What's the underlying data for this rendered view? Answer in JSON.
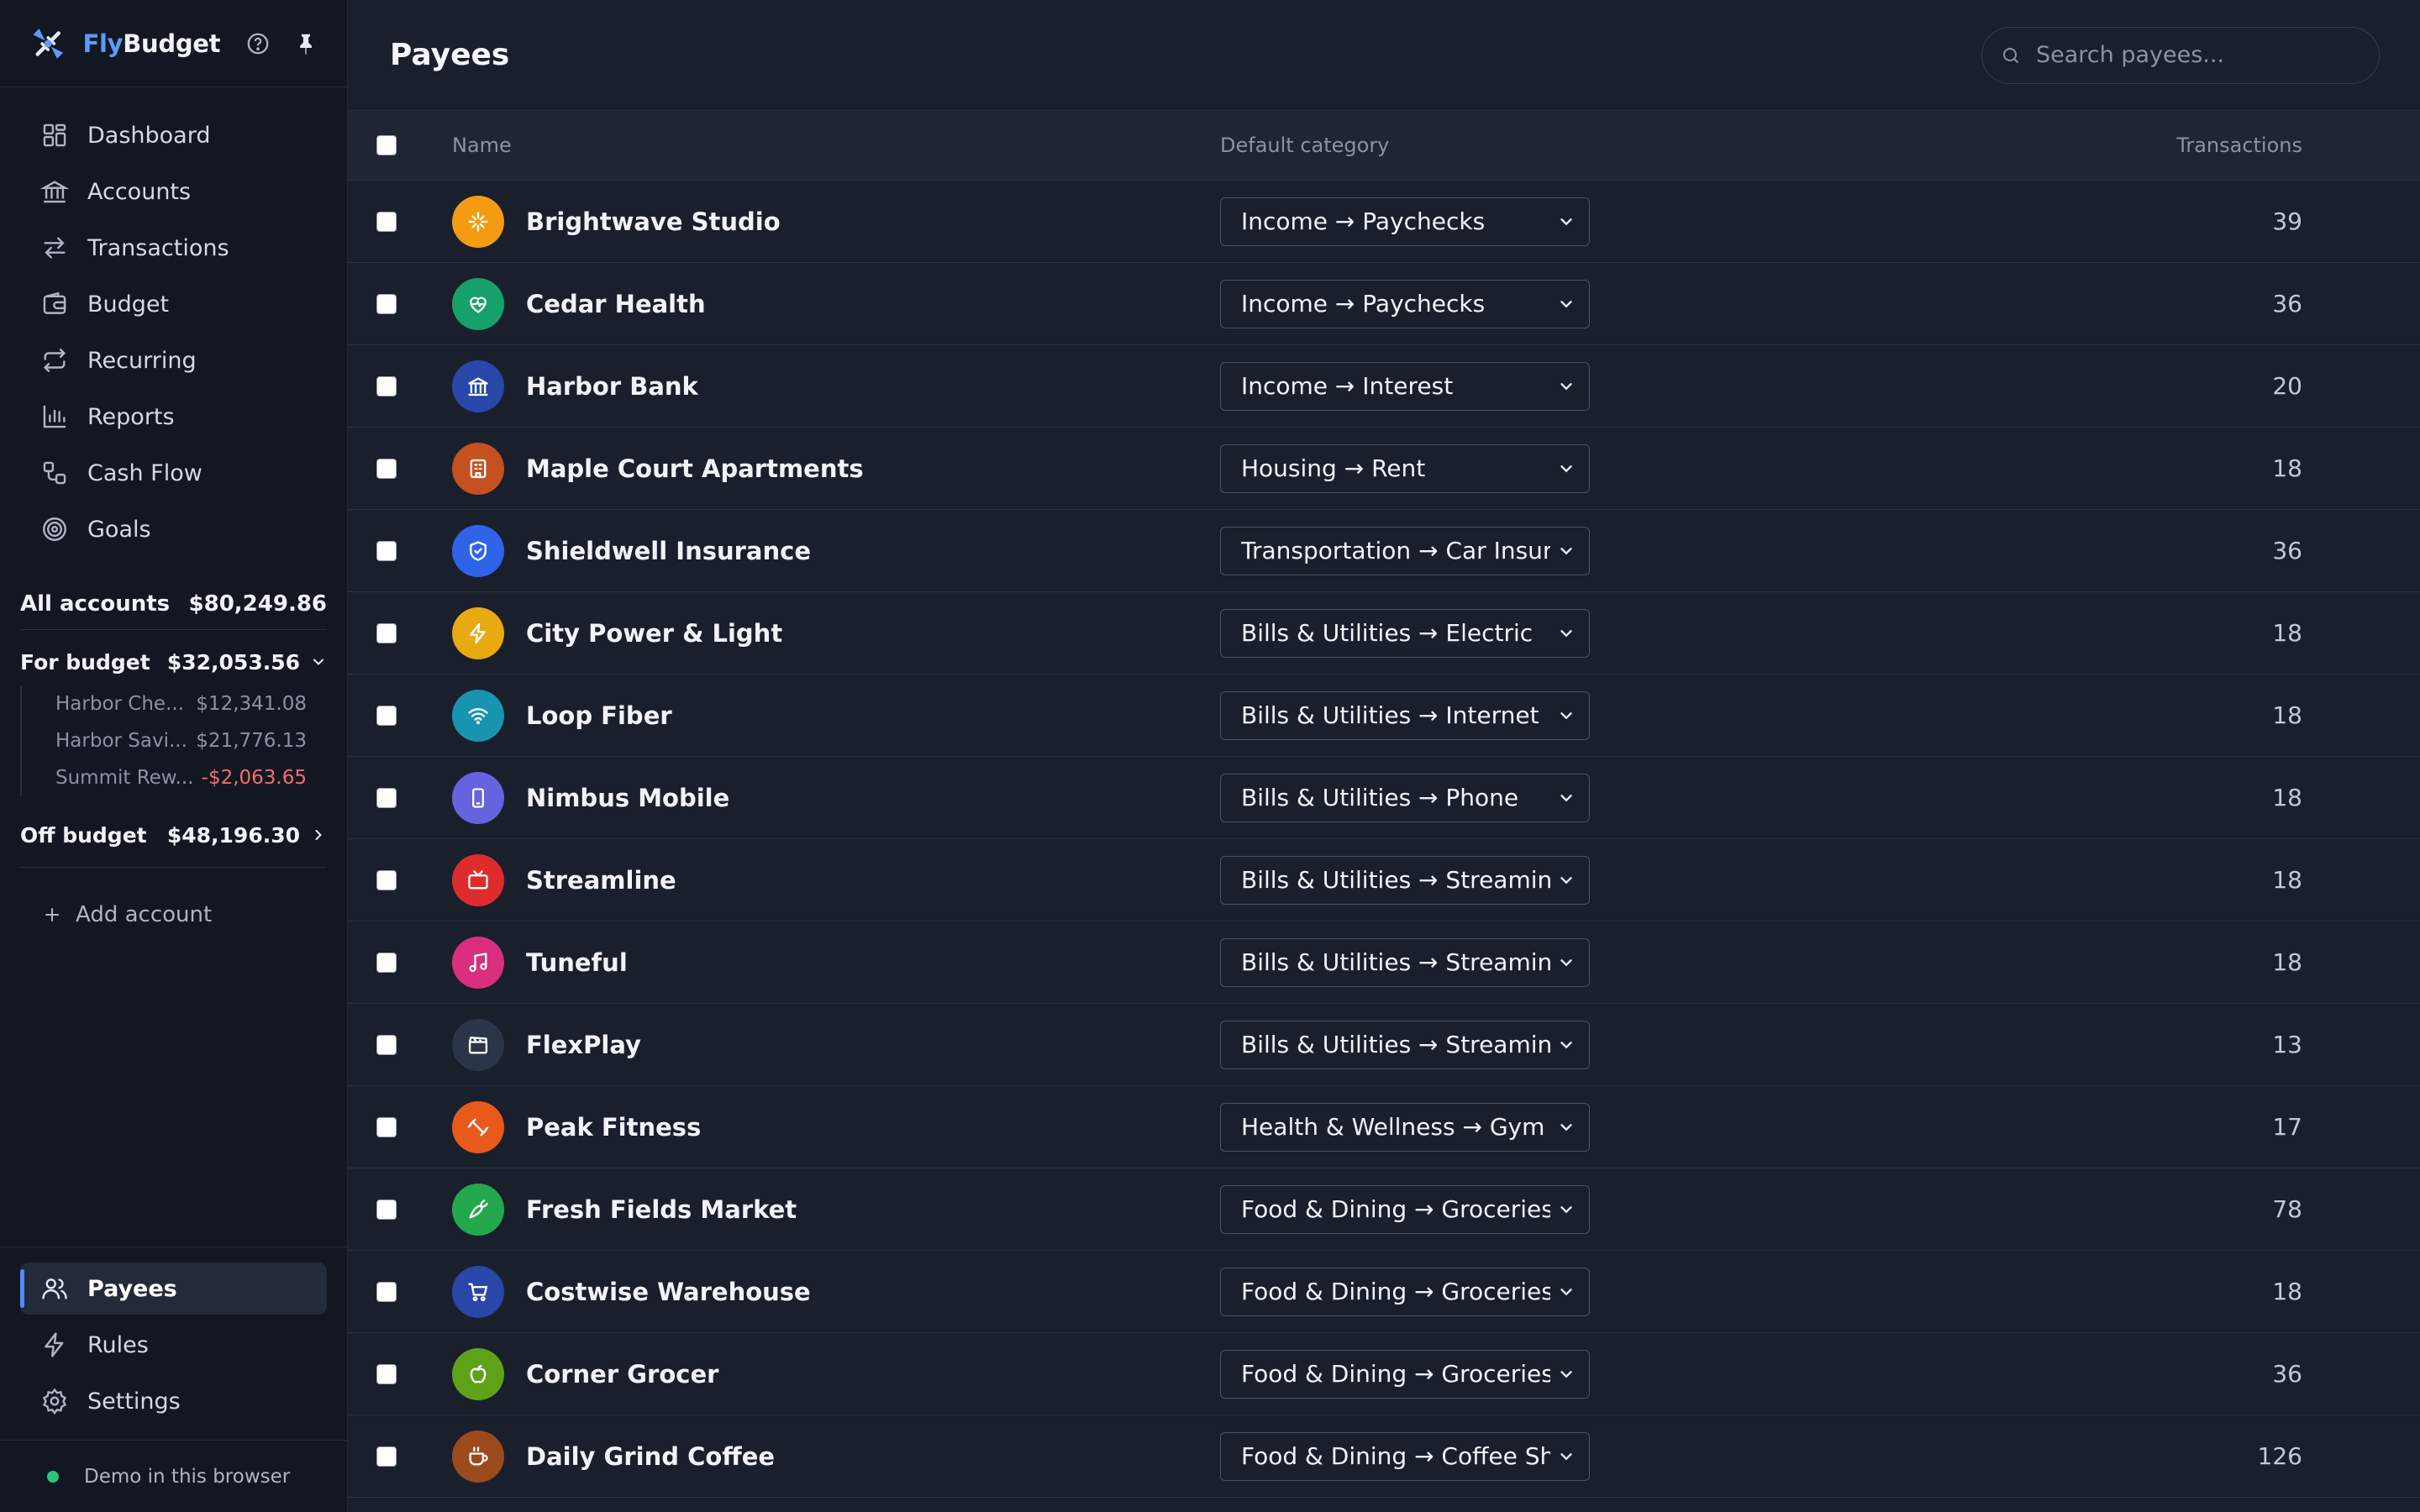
{
  "brand": {
    "fly": "Fly",
    "budget": "Budget"
  },
  "nav": [
    {
      "label": "Dashboard",
      "icon": "dashboard-icon"
    },
    {
      "label": "Accounts",
      "icon": "bank-icon"
    },
    {
      "label": "Transactions",
      "icon": "transfer-arrows-icon"
    },
    {
      "label": "Budget",
      "icon": "wallet-icon"
    },
    {
      "label": "Recurring",
      "icon": "repeat-icon"
    },
    {
      "label": "Reports",
      "icon": "bar-chart-icon"
    },
    {
      "label": "Cash Flow",
      "icon": "flow-icon"
    },
    {
      "label": "Goals",
      "icon": "target-icon"
    }
  ],
  "accounts": {
    "all_label": "All accounts",
    "all_amount": "$80,249.86",
    "for_budget": {
      "label": "For budget",
      "amount": "$32,053.56"
    },
    "sub": [
      {
        "name": "Harbor Che...",
        "amount": "$12,341.08",
        "negative": false
      },
      {
        "name": "Harbor Savi...",
        "amount": "$21,776.13",
        "negative": false
      },
      {
        "name": "Summit Rew...",
        "amount": "-$2,063.65",
        "negative": true
      }
    ],
    "off_budget": {
      "label": "Off budget",
      "amount": "$48,196.30"
    },
    "add_label": "Add account"
  },
  "bottom_nav": [
    {
      "label": "Payees",
      "icon": "users-icon",
      "active": true
    },
    {
      "label": "Rules",
      "icon": "lightning-icon",
      "active": false
    },
    {
      "label": "Settings",
      "icon": "gear-icon",
      "active": false
    }
  ],
  "footer": {
    "label": "Demo in this browser"
  },
  "page": {
    "title": "Payees",
    "search_placeholder": "Search payees..."
  },
  "table": {
    "headers": {
      "name": "Name",
      "category": "Default category",
      "transactions": "Transactions"
    },
    "rows": [
      {
        "name": "Brightwave Studio",
        "category": "Income → Paychecks",
        "count": "39",
        "color": "#f39c12",
        "icon": "sparkle-icon"
      },
      {
        "name": "Cedar Health",
        "category": "Income → Paychecks",
        "count": "36",
        "color": "#16a06a",
        "icon": "heart-pulse-icon"
      },
      {
        "name": "Harbor Bank",
        "category": "Income → Interest",
        "count": "20",
        "color": "#2847a8",
        "icon": "bank-icon"
      },
      {
        "name": "Maple Court Apartments",
        "category": "Housing → Rent",
        "count": "18",
        "color": "#c4511f",
        "icon": "building-icon"
      },
      {
        "name": "Shieldwell Insurance",
        "category": "Transportation → Car Insurance",
        "count": "36",
        "color": "#2f64e8",
        "icon": "shield-icon"
      },
      {
        "name": "City Power & Light",
        "category": "Bills & Utilities → Electric",
        "count": "18",
        "color": "#e8a911",
        "icon": "lightning-icon"
      },
      {
        "name": "Loop Fiber",
        "category": "Bills & Utilities → Internet",
        "count": "18",
        "color": "#1894b0",
        "icon": "wifi-icon"
      },
      {
        "name": "Nimbus Mobile",
        "category": "Bills & Utilities → Phone",
        "count": "18",
        "color": "#6563e0",
        "icon": "phone-icon"
      },
      {
        "name": "Streamline",
        "category": "Bills & Utilities → Streaming",
        "count": "18",
        "color": "#de2c2c",
        "icon": "tv-icon"
      },
      {
        "name": "Tuneful",
        "category": "Bills & Utilities → Streaming",
        "count": "18",
        "color": "#d92f7e",
        "icon": "music-icon"
      },
      {
        "name": "FlexPlay",
        "category": "Bills & Utilities → Streaming",
        "count": "13",
        "color": "#2c3547",
        "icon": "clapper-icon"
      },
      {
        "name": "Peak Fitness",
        "category": "Health & Wellness → Gym",
        "count": "17",
        "color": "#e85a1c",
        "icon": "dumbbell-icon"
      },
      {
        "name": "Fresh Fields Market",
        "category": "Food & Dining → Groceries",
        "count": "78",
        "color": "#23a84e",
        "icon": "carrot-icon"
      },
      {
        "name": "Costwise Warehouse",
        "category": "Food & Dining → Groceries",
        "count": "18",
        "color": "#2847a8",
        "icon": "cart-icon"
      },
      {
        "name": "Corner Grocer",
        "category": "Food & Dining → Groceries",
        "count": "36",
        "color": "#5ea21a",
        "icon": "apple-icon"
      },
      {
        "name": "Daily Grind Coffee",
        "category": "Food & Dining → Coffee Shops",
        "count": "126",
        "color": "#9b4a1c",
        "icon": "coffee-icon"
      }
    ]
  }
}
